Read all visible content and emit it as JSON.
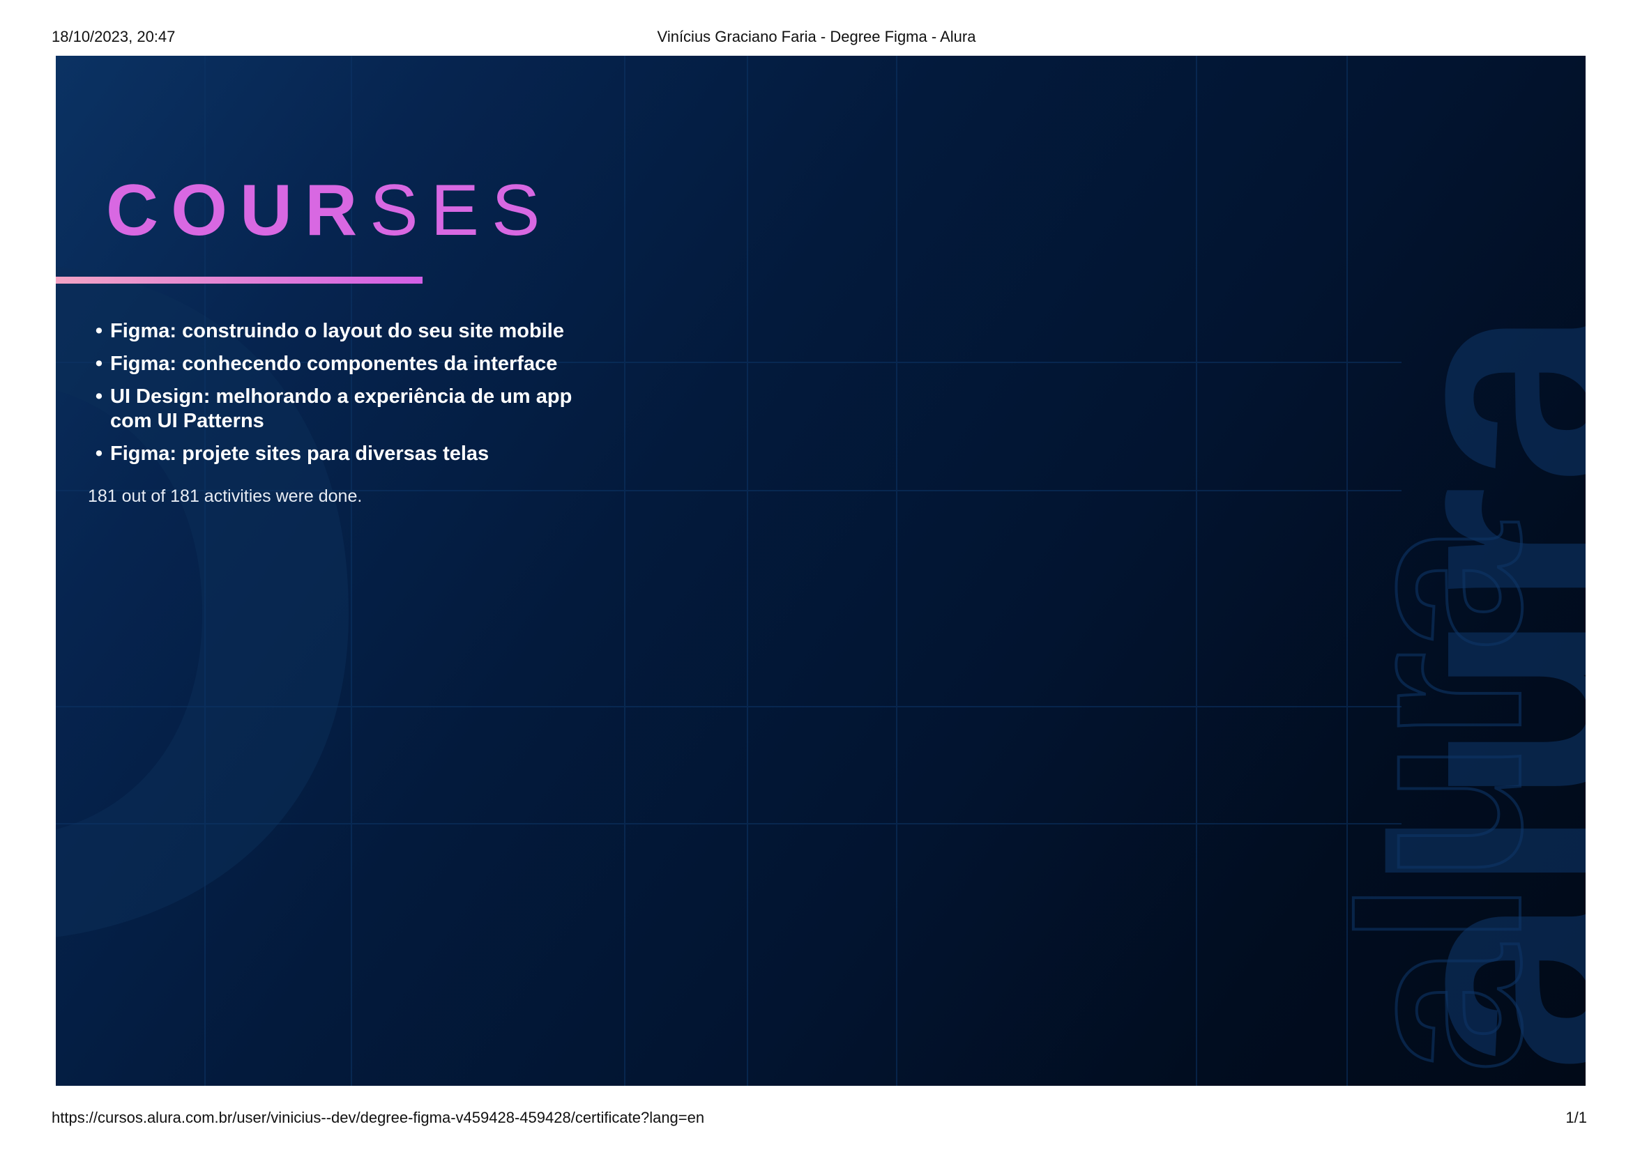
{
  "print_header": {
    "datetime": "18/10/2023, 20:47",
    "title": "Vinícius Graciano Faria - Degree Figma - Alura"
  },
  "certificate": {
    "heading_bold": "COUR",
    "heading_light": "SES",
    "courses": [
      "Figma: construindo o layout do seu site mobile",
      "Figma: conhecendo componentes da interface",
      "UI Design: melhorando a experiência de um app com UI Patterns",
      "Figma: projete sites para diversas telas"
    ],
    "activities_text": "181 out of 181 activities were done.",
    "watermark_text": "alura",
    "colors": {
      "heading": "#d868e2",
      "underline_start": "#f2a3c4",
      "underline_end": "#d25fe6",
      "background_dark": "#010a18",
      "background_light": "#0b3263"
    }
  },
  "print_footer": {
    "url": "https://cursos.alura.com.br/user/vinicius--dev/degree-figma-v459428-459428/certificate?lang=en",
    "page_number": "1/1"
  }
}
